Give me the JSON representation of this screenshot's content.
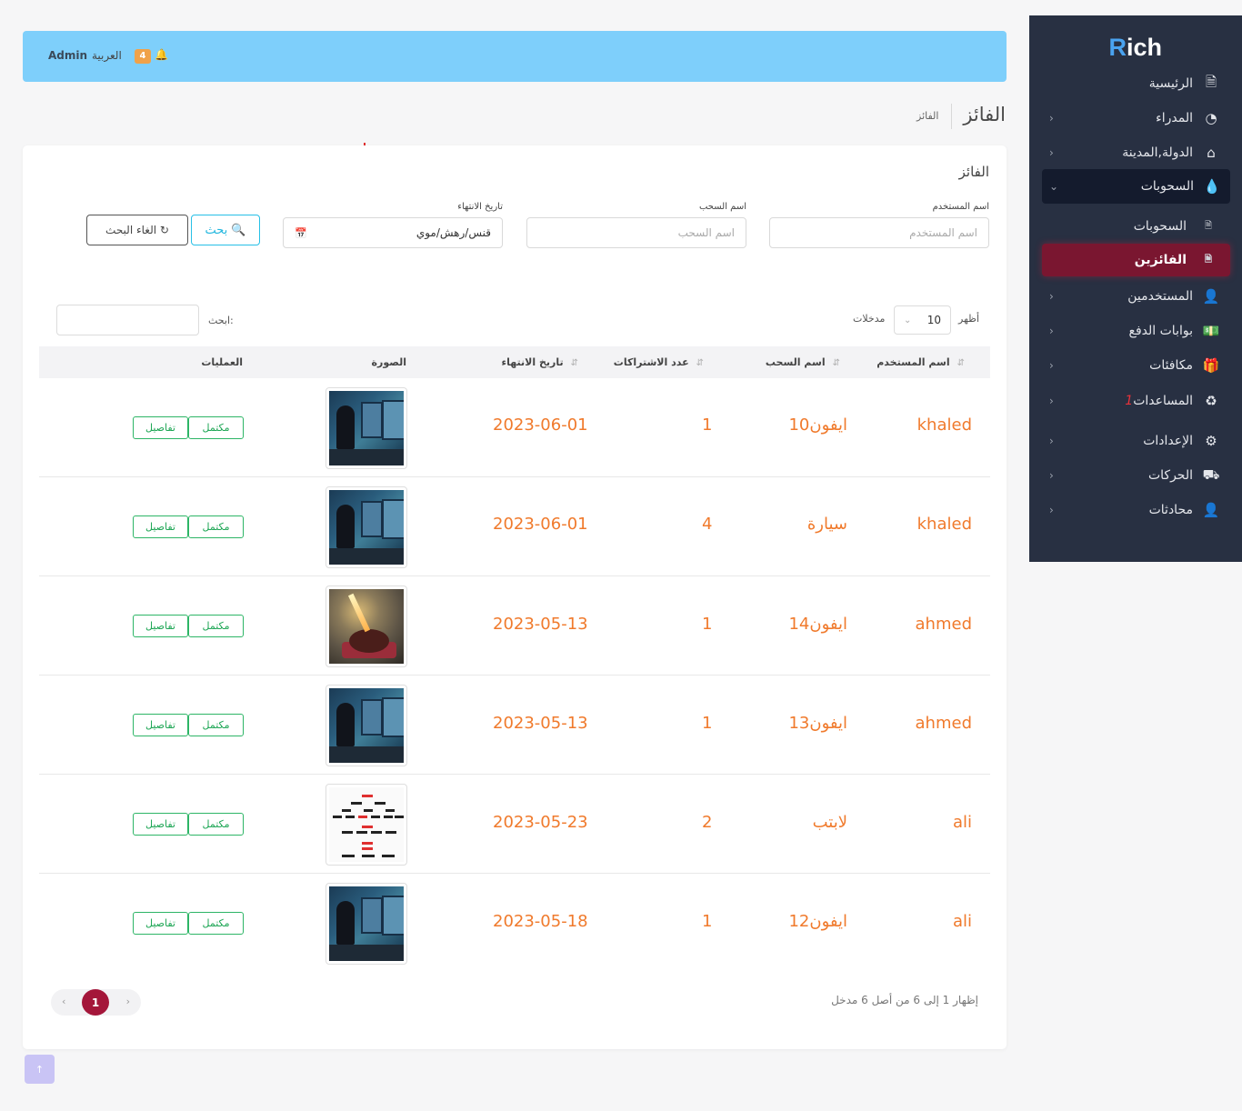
{
  "sidebar": {
    "logo_mark": "R",
    "logo_text": "ich",
    "items": [
      {
        "label": "الرئيسية",
        "icon": "document-icon"
      },
      {
        "label": "المدراء",
        "icon": "pie-chart-icon"
      },
      {
        "label": "الدولة,المدينة",
        "icon": "home-icon"
      },
      {
        "label": "السحوبات",
        "icon": "flame-icon"
      },
      {
        "label": "السحوبات",
        "icon": "file-icon"
      },
      {
        "label": "الفائزين",
        "icon": "file-icon"
      },
      {
        "label": "المستخدمين",
        "icon": "user-icon"
      },
      {
        "label": "بوابات الدفع",
        "icon": "money-icon"
      },
      {
        "label": "مكافئات",
        "icon": "gift-icon"
      },
      {
        "label": "المساعدات",
        "badge": "1",
        "icon": "recycle-icon"
      },
      {
        "label": "الإعدادات",
        "icon": "gear-icon"
      },
      {
        "label": "الحركات",
        "icon": "truck-icon"
      },
      {
        "label": "محادثات",
        "icon": "user-icon"
      }
    ]
  },
  "topbar": {
    "admin": "Admin",
    "language": "العربية",
    "notification_count": "4",
    "bg_color": "#7ecffb"
  },
  "page": {
    "title": "الفائز",
    "breadcrumb": "الفائز"
  },
  "card": {
    "title": "الفائز",
    "filters": {
      "username_label": "اسم المستخدم",
      "username_placeholder": "اسم المستخدم",
      "draw_label": "اسم السحب",
      "draw_placeholder": "اسم السحب",
      "end_date_label": "تاريخ الانتهاء",
      "end_date_value": "قنس/رهش/موي"
    },
    "search_button": "بحث",
    "cancel_button": "الغاء البحث"
  },
  "table_controls": {
    "show_label": "أظهر",
    "page_length": "10",
    "entries_label": "مدخلات",
    "search_label": "ابحث:"
  },
  "table": {
    "headers": [
      "اسم المستخدم",
      "اسم السحب",
      "عدد الاشتراكات",
      "تاريخ الانتهاء",
      "الصورة",
      "العمليات"
    ],
    "rows": [
      {
        "user": "khaled",
        "draw": "ايفون10",
        "count": "1",
        "end": "2023-06-01",
        "image": "tech"
      },
      {
        "user": "khaled",
        "draw": "سيارة",
        "count": "4",
        "end": "2023-06-01",
        "image": "tech"
      },
      {
        "user": "ahmed",
        "draw": "ايفون14",
        "count": "1",
        "end": "2023-05-13",
        "image": "cake"
      },
      {
        "user": "ahmed",
        "draw": "ايفون13",
        "count": "1",
        "end": "2023-05-13",
        "image": "tech"
      },
      {
        "user": "ali",
        "draw": "لابتب",
        "count": "2",
        "end": "2023-05-23",
        "image": "diagram"
      },
      {
        "user": "ali",
        "draw": "ايفون12",
        "count": "1",
        "end": "2023-05-18",
        "image": "tech"
      }
    ],
    "action_complete": "مكتمل",
    "action_details": "تفاصيل"
  },
  "footer": {
    "info": "إظهار 1 إلى 6 من أصل 6 مدخل",
    "current_page": "1",
    "prev": "‹",
    "next": "›"
  },
  "colors": {
    "sidebar_bg": "#283042",
    "active_item": "#7a1630",
    "accent_orange": "#f07a2c",
    "success_green": "#2db566"
  }
}
